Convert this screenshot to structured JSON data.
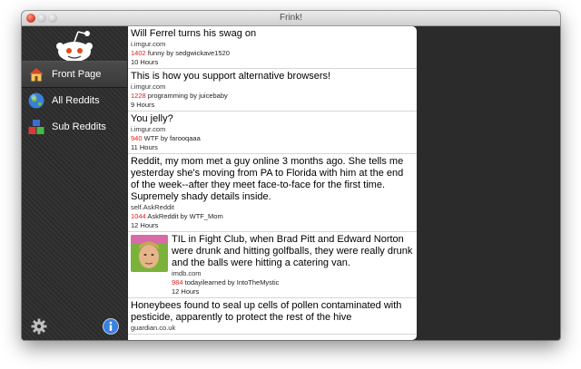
{
  "window": {
    "title": "Frink!"
  },
  "sidebar": {
    "items": [
      {
        "label": "Front Page",
        "icon": "home-icon",
        "active": true
      },
      {
        "label": "All Reddits",
        "icon": "globe-icon",
        "active": false
      },
      {
        "label": "Sub Reddits",
        "icon": "blocks-icon",
        "active": false
      }
    ],
    "footer": {
      "settings_icon": "gear-icon",
      "info_icon": "info-icon"
    }
  },
  "posts": [
    {
      "title": "Will Ferrel turns his swag on",
      "domain": "i.imgur.com",
      "score": "1402",
      "subreddit": "funny",
      "author": "by sedgwickave1520",
      "time": "10 Hours"
    },
    {
      "title": "This is how you support alternative browsers!",
      "domain": "i.imgur.com",
      "score": "1228",
      "subreddit": "programming",
      "author": "by juicebaby",
      "time": "9 Hours"
    },
    {
      "title": "You jelly?",
      "domain": "i.imgur.com",
      "score": "940",
      "subreddit": "WTF",
      "author": "by farooqaaa",
      "time": "11 Hours"
    },
    {
      "title": "Reddit, my mom met a guy online 3 months ago. She tells me yesterday she's moving from PA to Florida with him at the end of the week--after they meet face-to-face for the first time. Supremely shady details inside.",
      "domain": "self.AskReddit",
      "score": "1044",
      "subreddit": "AskReddit",
      "author": "by WTF_Mom",
      "time": "12 Hours"
    },
    {
      "title": "TIL in Fight Club, when Brad Pitt and Edward Norton were drunk and hitting golfballs, they were really drunk and the balls were hitting a catering van.",
      "domain": "imdb.com",
      "score": "984",
      "subreddit": "todayilearned",
      "author": "by IntoTheMystic",
      "time": "12 Hours",
      "thumbnail": true
    },
    {
      "title": "Honeybees found to seal up cells of pollen contaminated with pesticide, apparently to protect the rest of the hive",
      "domain": "guardian.co.uk",
      "score": "",
      "subreddit": "",
      "author": "",
      "time": ""
    }
  ],
  "colors": {
    "score": "#e02020",
    "sidebar_bg": "#2d2d2d"
  }
}
